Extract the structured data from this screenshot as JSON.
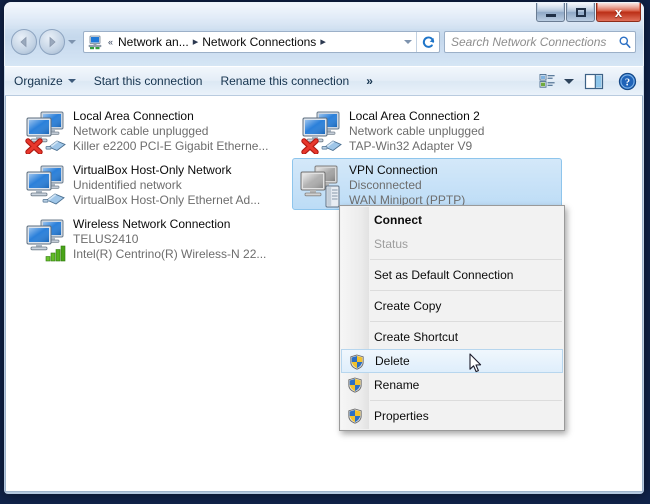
{
  "window": {
    "controls": {
      "minimize_label": "Minimize",
      "maximize_label": "Maximize",
      "close_label": "x"
    }
  },
  "address_bar": {
    "back_label": "Back",
    "forward_label": "Forward",
    "recent_pages_label": "Recent pages",
    "breadcrumb": [
      {
        "label": "Network an...",
        "icon": "network-folder-icon"
      },
      {
        "label": "Network Connections",
        "icon": ""
      }
    ],
    "overflow_label": "«",
    "separator": "▸",
    "refresh_label": "Refresh",
    "dropdown_label": "Previous locations"
  },
  "search": {
    "placeholder": "Search Network Connections",
    "icon": "search-icon"
  },
  "toolbar": {
    "organize_label": "Organize",
    "start_connection_label": "Start this connection",
    "rename_connection_label": "Rename this connection",
    "overflow_label": "»",
    "change_view_label": "Change your view",
    "preview_pane_label": "Show the preview pane",
    "help_label": "Get help"
  },
  "connections": [
    {
      "name": "Local Area Connection",
      "status": "Network cable unplugged",
      "adapter": "Killer e2200 PCI-E Gigabit Etherne...",
      "icon": "lan-adapter-icon",
      "state": "unplugged",
      "selected": false
    },
    {
      "name": "Local Area Connection 2",
      "status": "Network cable unplugged",
      "adapter": "TAP-Win32 Adapter V9",
      "icon": "lan-adapter-icon",
      "state": "unplugged",
      "selected": false
    },
    {
      "name": "VirtualBox Host-Only Network",
      "status": "Unidentified network",
      "adapter": "VirtualBox Host-Only Ethernet Ad...",
      "icon": "lan-adapter-icon",
      "state": "unidentified",
      "selected": false
    },
    {
      "name": "VPN Connection",
      "status": "Disconnected",
      "adapter": "WAN Miniport (PPTP)",
      "icon": "vpn-adapter-icon",
      "state": "disconnected",
      "selected": true
    },
    {
      "name": "Wireless Network Connection",
      "status": "TELUS2410",
      "adapter": "Intel(R) Centrino(R) Wireless-N 22...",
      "icon": "wireless-adapter-icon",
      "state": "connected",
      "selected": false
    }
  ],
  "context_menu": {
    "items": [
      {
        "label": "Connect",
        "bold": true,
        "disabled": false,
        "shield": false,
        "hover": false,
        "separator_after": false
      },
      {
        "label": "Status",
        "bold": false,
        "disabled": true,
        "shield": false,
        "hover": false,
        "separator_after": true
      },
      {
        "label": "Set as Default Connection",
        "bold": false,
        "disabled": false,
        "shield": false,
        "hover": false,
        "separator_after": true
      },
      {
        "label": "Create Copy",
        "bold": false,
        "disabled": false,
        "shield": false,
        "hover": false,
        "separator_after": true
      },
      {
        "label": "Create Shortcut",
        "bold": false,
        "disabled": false,
        "shield": false,
        "hover": false,
        "separator_after": false
      },
      {
        "label": "Delete",
        "bold": false,
        "disabled": false,
        "shield": true,
        "hover": true,
        "separator_after": false
      },
      {
        "label": "Rename",
        "bold": false,
        "disabled": false,
        "shield": true,
        "hover": false,
        "separator_after": true
      },
      {
        "label": "Properties",
        "bold": false,
        "disabled": false,
        "shield": true,
        "hover": false,
        "separator_after": false
      }
    ]
  },
  "colors": {
    "selection_blue": "#bcdcf6",
    "hover_blue": "#dfeefb",
    "close_red": "#bb2f17",
    "monitor_blue": "#1f79d8",
    "signal_green": "#3d9c18",
    "error_red": "#d6312a",
    "shield_blue": "#2b6fc4",
    "shield_yellow": "#f2c22c"
  }
}
